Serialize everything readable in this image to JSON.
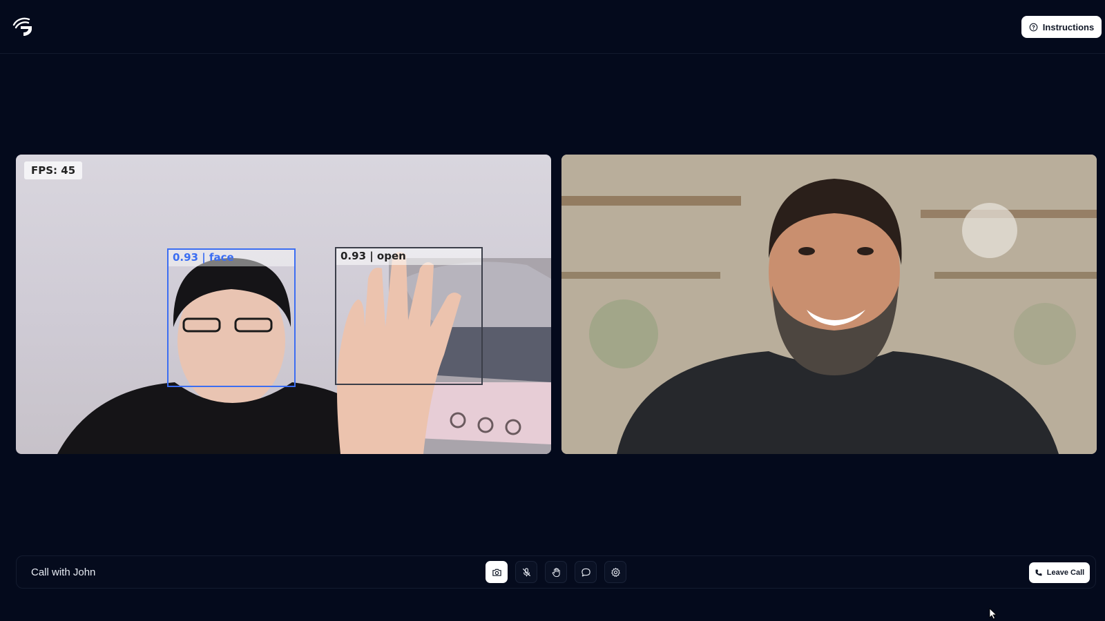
{
  "header": {
    "logo_icon": "app-logo-icon",
    "instructions_label": "Instructions",
    "instructions_icon": "help-circle-icon"
  },
  "video": {
    "local": {
      "fps_text": "FPS: 45",
      "detections": [
        {
          "label": "0.93 | face",
          "color": "#3b6df2"
        },
        {
          "label": "0.93 | open",
          "color": "#3a3d48"
        }
      ]
    },
    "remote": {}
  },
  "controls": {
    "call_title": "Call with John",
    "buttons": [
      {
        "name": "camera-button",
        "icon": "camera-icon",
        "active": true
      },
      {
        "name": "mute-button",
        "icon": "mic-off-icon",
        "active": false
      },
      {
        "name": "raise-hand-button",
        "icon": "hand-icon",
        "active": false
      },
      {
        "name": "chat-button",
        "icon": "chat-bubble-icon",
        "active": false
      },
      {
        "name": "settings-button",
        "icon": "gear-icon",
        "active": false
      }
    ],
    "leave_label": "Leave Call",
    "leave_icon": "phone-icon"
  },
  "colors": {
    "background": "#040a1c",
    "accent_face_box": "#3b6df2",
    "button_bg": "#ffffff"
  }
}
